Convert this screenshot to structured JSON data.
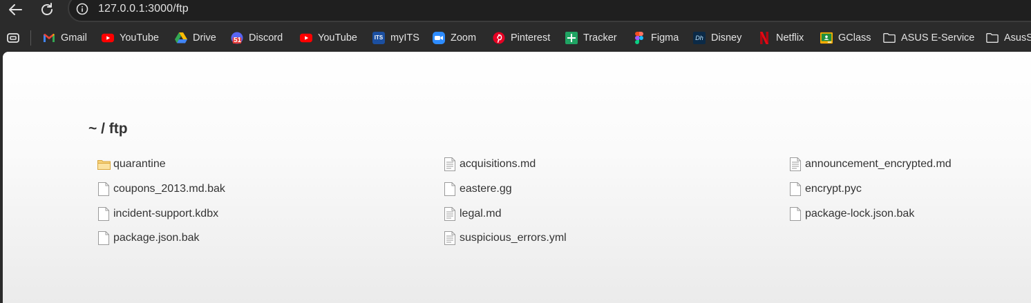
{
  "browser": {
    "url": "127.0.0.1:3000/ftp"
  },
  "bookmarks": [
    {
      "label": "Gmail",
      "icon": "gmail-icon"
    },
    {
      "label": "YouTube",
      "icon": "youtube-icon"
    },
    {
      "label": "Drive",
      "icon": "drive-icon"
    },
    {
      "label": "Discord",
      "icon": "discord-icon",
      "badge": "51"
    },
    {
      "label": "YouTube",
      "icon": "youtube-icon"
    },
    {
      "label": "myITS",
      "icon": "myits-icon",
      "icon_text": "ITS"
    },
    {
      "label": "Zoom",
      "icon": "zoom-icon"
    },
    {
      "label": "Pinterest",
      "icon": "pinterest-icon"
    },
    {
      "label": "Tracker",
      "icon": "tracker-icon"
    },
    {
      "label": "Figma",
      "icon": "figma-icon"
    },
    {
      "label": "Disney",
      "icon": "disney-icon",
      "icon_text": "Dh"
    },
    {
      "label": "Netflix",
      "icon": "netflix-icon"
    },
    {
      "label": "GClass",
      "icon": "gclass-icon"
    },
    {
      "label": "ASUS E-Service",
      "icon": "folder-icon"
    },
    {
      "label": "AsusS",
      "icon": "folder-icon"
    }
  ],
  "listing": {
    "title": "~ / ftp",
    "files": [
      {
        "name": "quarantine",
        "type": "folder"
      },
      {
        "name": "acquisitions.md",
        "type": "text"
      },
      {
        "name": "announcement_encrypted.md",
        "type": "text"
      },
      {
        "name": "coupons_2013.md.bak",
        "type": "file"
      },
      {
        "name": "eastere.gg",
        "type": "file"
      },
      {
        "name": "encrypt.pyc",
        "type": "file"
      },
      {
        "name": "incident-support.kdbx",
        "type": "file"
      },
      {
        "name": "legal.md",
        "type": "text"
      },
      {
        "name": "package-lock.json.bak",
        "type": "file"
      },
      {
        "name": "package.json.bak",
        "type": "file"
      },
      {
        "name": "suspicious_errors.yml",
        "type": "text"
      }
    ]
  },
  "colors": {
    "chrome_bg": "#2b2b2b",
    "omnibox_bg": "#1f1f1f",
    "page_text": "#333333",
    "folder_yellow": "#f2c14e"
  }
}
